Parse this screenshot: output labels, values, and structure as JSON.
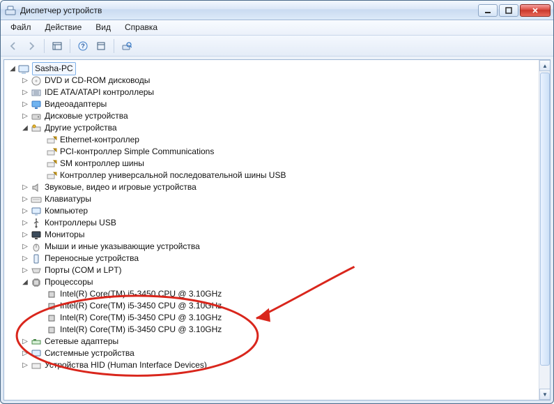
{
  "window": {
    "title": "Диспетчер устройств"
  },
  "menu": {
    "file": "Файл",
    "action": "Действие",
    "view": "Вид",
    "help": "Справка"
  },
  "tree": {
    "root": "Sasha-PC",
    "dvd": "DVD и CD-ROM дисководы",
    "ide": "IDE ATA/ATAPI контроллеры",
    "video": "Видеоадаптеры",
    "disk": "Дисковые устройства",
    "other": "Другие устройства",
    "other_items": {
      "eth": "Ethernet-контроллер",
      "pci": "PCI-контроллер Simple Communications",
      "sm": "SM контроллер шины",
      "usb": "Контроллер универсальной последовательной шины USB"
    },
    "sound": "Звуковые, видео и игровые устройства",
    "keyboards": "Клавиатуры",
    "computer": "Компьютер",
    "usb_ctrl": "Контроллеры USB",
    "monitors": "Мониторы",
    "mice": "Мыши и иные указывающие устройства",
    "portable": "Переносные устройства",
    "ports": "Порты (COM и LPT)",
    "processors": "Процессоры",
    "proc_items": {
      "p0": "Intel(R) Core(TM) i5-3450 CPU @ 3.10GHz",
      "p1": "Intel(R) Core(TM) i5-3450 CPU @ 3.10GHz",
      "p2": "Intel(R) Core(TM) i5-3450 CPU @ 3.10GHz",
      "p3": "Intel(R) Core(TM) i5-3450 CPU @ 3.10GHz"
    },
    "network": "Сетевые адаптеры",
    "system": "Системные устройства",
    "hid": "Устройства HID (Human Interface Devices)"
  },
  "colors": {
    "annotation": "#d9261c"
  }
}
